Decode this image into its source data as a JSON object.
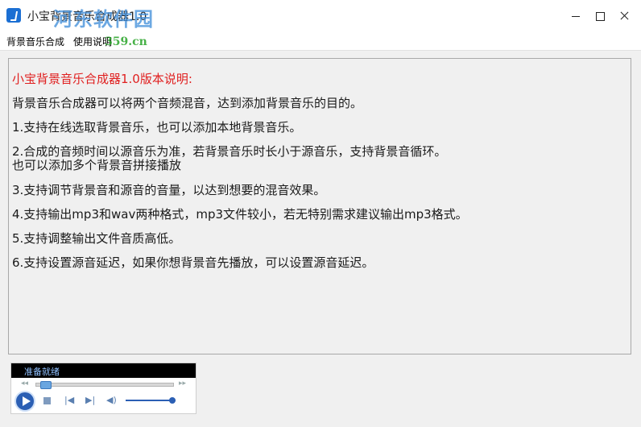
{
  "window": {
    "title": "小宝背景音乐合成器1.0",
    "watermark": "河东软件园",
    "watermark_url": "359.cn"
  },
  "menu": {
    "items": [
      "背景音乐合成",
      "使用说明"
    ]
  },
  "document": {
    "title": "小宝背景音乐合成器1.0版本说明:",
    "lines": [
      "背景音乐合成器可以将两个音频混音，达到添加背景音乐的目的。",
      "1.支持在线选取背景音乐，也可以添加本地背景音乐。",
      "2.合成的音频时间以源音乐为准，若背景音乐时长小于源音乐，支持背景音循环。",
      "也可以添加多个背景音拼接播放",
      "3.支持调节背景音和源音的音量，以达到想要的混音效果。",
      "4.支持输出mp3和wav两种格式，mp3文件较小，若无特别需求建议输出mp3格式。",
      "5.支持调整输出文件音质高低。",
      "6.支持设置源音延迟，如果你想背景音先播放，可以设置源音延迟。"
    ]
  },
  "player": {
    "status": "准备就绪",
    "seek_position": 0.03,
    "volume": 1.0
  },
  "colors": {
    "doc_title": "#e02020",
    "player_accent": "#2b5fb4",
    "status_text": "#8fc0ff"
  }
}
